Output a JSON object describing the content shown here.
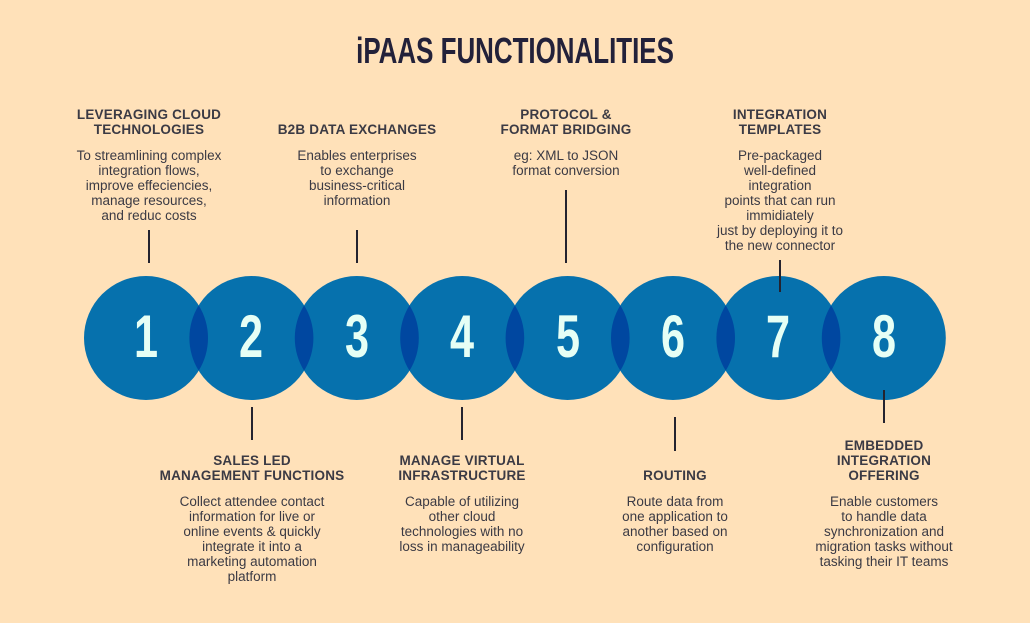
{
  "title": "iPAAS FUNCTIONALITIES",
  "colors": {
    "background": "#FFE1B9",
    "circle": "#0671AD",
    "overlap": "#0047A0",
    "digit": "#E6FFF5",
    "text": "#3B3A44",
    "title": "#23213A",
    "connector": "#24232F"
  },
  "steps": [
    {
      "number": "1",
      "position": "top",
      "heading": [
        "LEVERAGING CLOUD",
        "TECHNOLOGIES"
      ],
      "description": [
        "To streamlining complex",
        "integration flows,",
        "improve effeciencies,",
        "manage resources,",
        "and reduc costs"
      ]
    },
    {
      "number": "2",
      "position": "bottom",
      "heading": [
        "SALES LED",
        "MANAGEMENT FUNCTIONS"
      ],
      "description": [
        "Collect attendee contact",
        "information for live or",
        "online events & quickly",
        "integrate it into a",
        "marketing automation",
        "platform"
      ]
    },
    {
      "number": "3",
      "position": "top",
      "heading": [
        "B2B DATA EXCHANGES"
      ],
      "description": [
        "Enables enterprises",
        "to exchange",
        "business-critical",
        "information"
      ]
    },
    {
      "number": "4",
      "position": "bottom",
      "heading": [
        "MANAGE VIRTUAL",
        "INFRASTRUCTURE"
      ],
      "description": [
        "Capable of utilizing",
        "other cloud",
        "technologies with no",
        "loss in manageability"
      ]
    },
    {
      "number": "5",
      "position": "top",
      "heading": [
        "PROTOCOL &",
        "FORMAT BRIDGING"
      ],
      "description": [
        "eg: XML to JSON",
        "format conversion"
      ]
    },
    {
      "number": "6",
      "position": "bottom",
      "heading": [
        "ROUTING"
      ],
      "description": [
        "Route data from",
        "one application to",
        "another based on",
        "configuration"
      ]
    },
    {
      "number": "7",
      "position": "top",
      "heading": [
        "INTEGRATION",
        "TEMPLATES"
      ],
      "description": [
        "Pre-packaged",
        "well-defined",
        "integration",
        "points that can run",
        "immidiately",
        "just by deploying it to",
        "the new connector"
      ]
    },
    {
      "number": "8",
      "position": "bottom",
      "heading": [
        "EMBEDDED",
        "INTEGRATION",
        "OFFERING"
      ],
      "description": [
        "Enable customers",
        "to handle data",
        "synchronization and",
        "migration tasks without",
        "tasking their IT teams"
      ]
    }
  ]
}
